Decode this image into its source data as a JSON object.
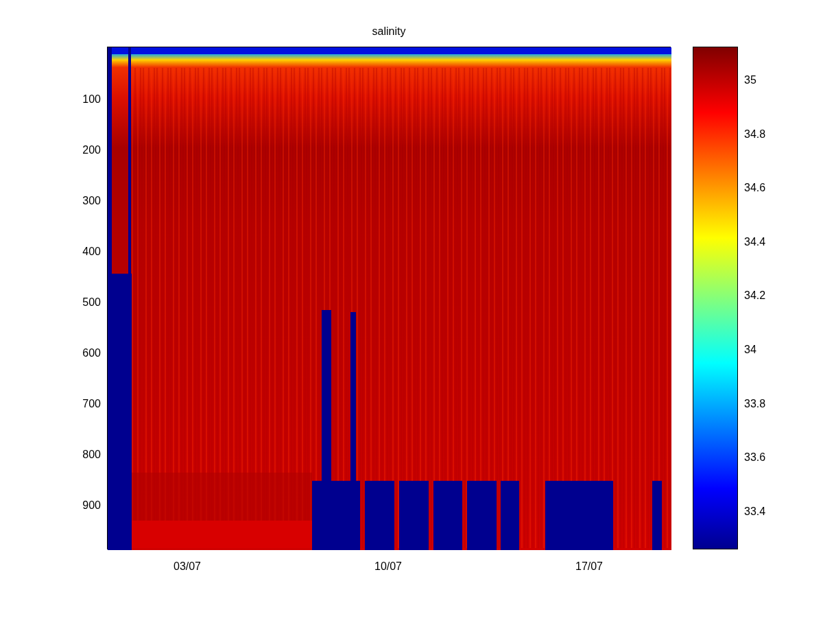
{
  "figure": {
    "title": "salinity",
    "y_ticks": [
      "100",
      "200",
      "300",
      "400",
      "500",
      "600",
      "700",
      "800",
      "900"
    ],
    "x_ticks": [
      "03/07",
      "10/07",
      "17/07"
    ],
    "colorbar": {
      "ticks": [
        "35",
        "34.8",
        "34.6",
        "34.4",
        "34.2",
        "34",
        "33.8",
        "33.6",
        "33.4"
      ]
    }
  }
}
